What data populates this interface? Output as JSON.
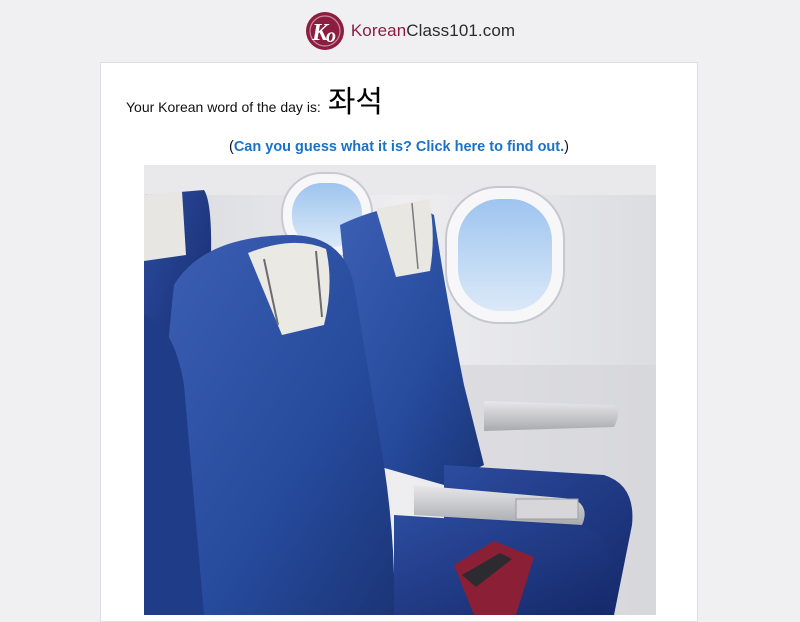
{
  "header": {
    "logo_icon": "ko-logo-icon",
    "logo_brand": "Korean",
    "logo_rest": "Class101.com",
    "brand_color": "#8c1d3f"
  },
  "wotd": {
    "label": "Your Korean word of the day is:",
    "word": "좌석"
  },
  "hint": {
    "open_paren": "(",
    "link_text": "Can you guess what it is? Click here to find out.",
    "close_paren": ")",
    "link_color": "#1a72c8"
  },
  "image": {
    "subject": "airplane-seats-image"
  }
}
